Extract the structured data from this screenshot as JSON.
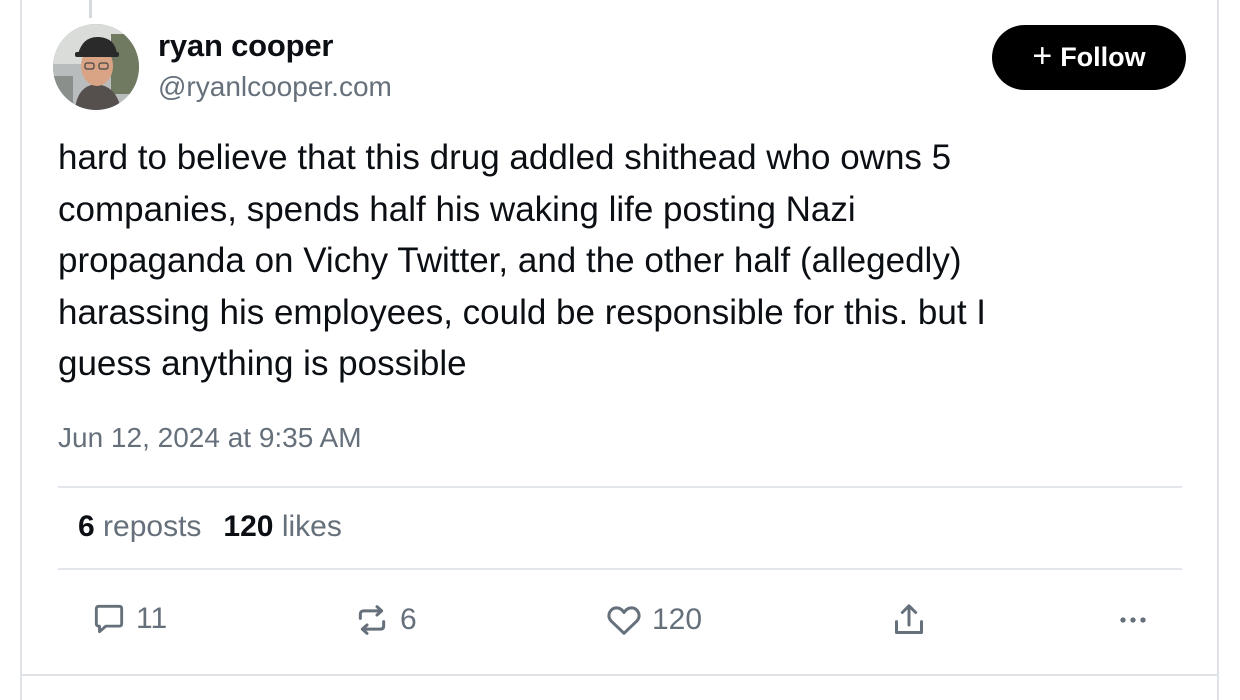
{
  "author": {
    "display_name": "ryan cooper",
    "handle": "@ryanlcooper.com"
  },
  "follow_button": {
    "label": "Follow",
    "icon": "plus-icon"
  },
  "post": {
    "text": "hard to believe that this drug addled shithead who owns 5\ncompanies, spends half his waking life posting Nazi\npropaganda on Vichy Twitter, and the other half (allegedly)\nharassing his employees, could be responsible for this. but I\nguess anything is possible",
    "timestamp": "Jun 12, 2024 at 9:35 AM"
  },
  "stats": {
    "reposts_count": "6",
    "reposts_label": "reposts",
    "likes_count": "120",
    "likes_label": "likes"
  },
  "actions": {
    "reply": {
      "icon": "reply-icon",
      "count": "11"
    },
    "repost": {
      "icon": "repost-icon",
      "count": "6"
    },
    "like": {
      "icon": "heart-icon",
      "count": "120"
    },
    "share": {
      "icon": "share-icon"
    },
    "more": {
      "icon": "more-icon"
    }
  },
  "colors": {
    "text": "#0b0f14",
    "muted": "#66707b",
    "follow_bg": "#000000",
    "follow_text": "#ffffff",
    "divider": "#e3e6ea"
  }
}
